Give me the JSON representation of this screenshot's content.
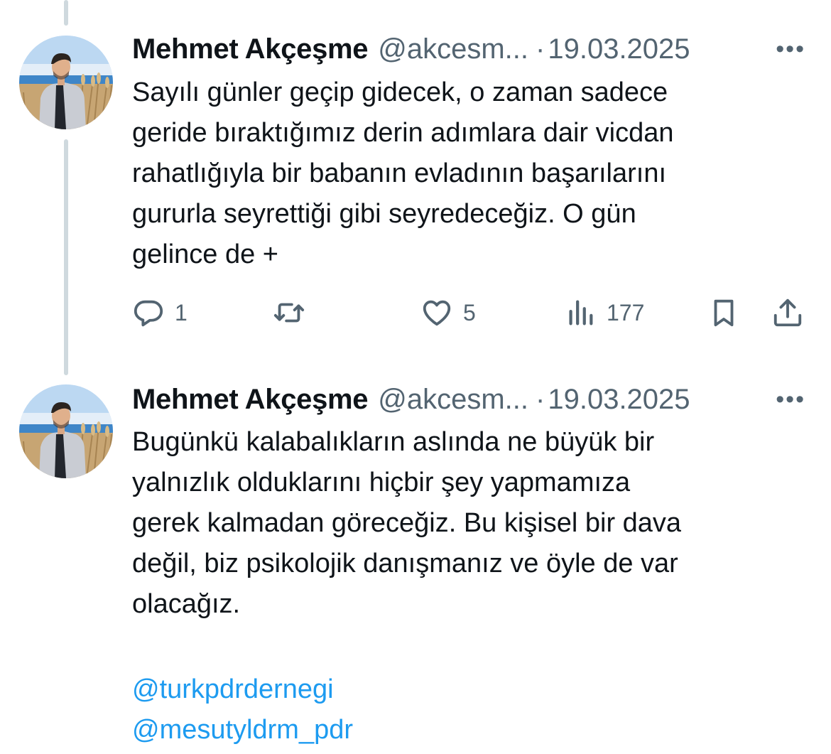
{
  "tweets": [
    {
      "author_name": "Mehmet Akçeşme",
      "handle": "@akcesm...",
      "separator": "·",
      "date": "19.03.2025",
      "more_label": "•••",
      "text": "Sayılı günler geçip gidecek, o zaman sadece\ngeride bıraktığımız derin adımlara dair vicdan\nrahatlığıyla bir babanın evladının başarılarını\ngururla seyrettiği gibi seyredeceğiz. O gün\ngelince de +",
      "actions": {
        "replies": "1",
        "likes": "5",
        "views": "177"
      },
      "icons": [
        "reply-icon",
        "retweet-icon",
        "like-icon",
        "views-icon",
        "bookmark-icon",
        "share-icon"
      ]
    },
    {
      "author_name": "Mehmet Akçeşme",
      "handle": "@akcesm...",
      "separator": "·",
      "date": "19.03.2025",
      "more_label": "•••",
      "text": "Bugünkü kalabalıkların aslında ne büyük bir\nyalnızlık olduklarını hiçbir şey yapmamıza\ngerek kalmadan göreceğiz. Bu kişisel bir dava\ndeğil, biz psikolojik danışmanız ve öyle de var\nolacağız.",
      "mentions": [
        "@turkpdrdernegi",
        "@mesutyldrm_pdr"
      ]
    }
  ],
  "colors": {
    "text": "#0f1419",
    "secondary": "#536471",
    "link": "#1d9bf0",
    "thread_line": "#cfd9de"
  }
}
